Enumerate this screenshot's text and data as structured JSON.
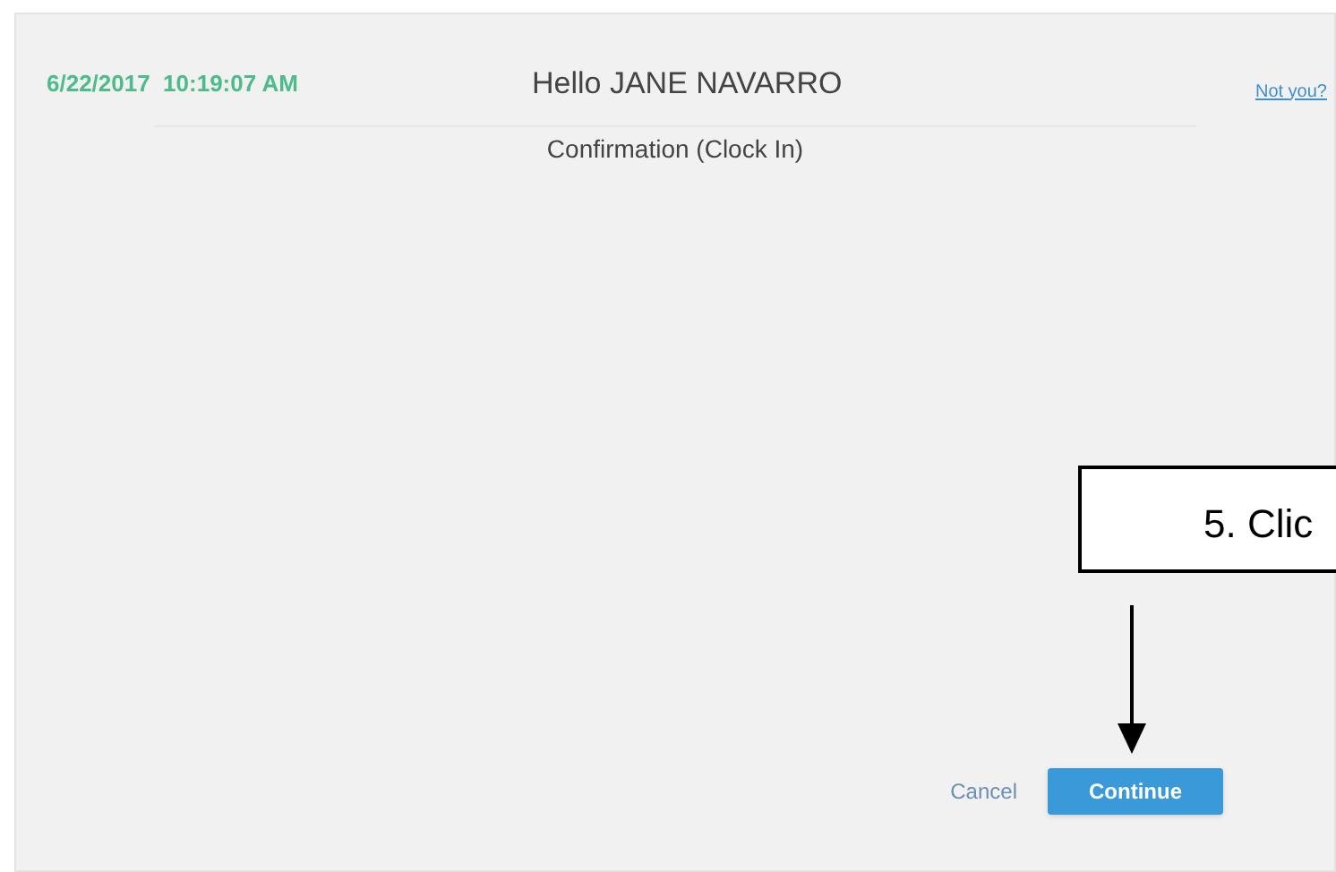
{
  "header": {
    "datetime": "6/22/2017  10:19:07 AM",
    "greeting": "Hello JANE NAVARRO",
    "not_you_link": "Not you?"
  },
  "subtitle": "Confirmation (Clock In)",
  "callout": {
    "text": "5. Clic"
  },
  "buttons": {
    "cancel": "Cancel",
    "continue": "Continue"
  }
}
